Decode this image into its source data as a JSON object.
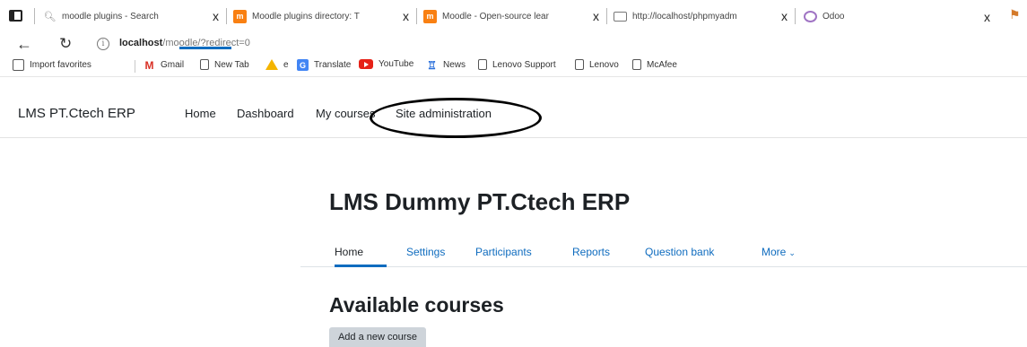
{
  "browser": {
    "tabs": [
      {
        "title": "moodle plugins - Search",
        "icon": "search-icon"
      },
      {
        "title": "Moodle plugins directory: T",
        "icon": "moodle-icon"
      },
      {
        "title": "Moodle - Open-source lear",
        "icon": "moodle-icon"
      },
      {
        "title": "http://localhost/phpmyadm",
        "icon": "page-icon"
      },
      {
        "title": "Odoo",
        "icon": "odoo-icon"
      }
    ],
    "tab_close_glyph": "x",
    "address": {
      "host": "localhost",
      "path": "/moodle/?redirect=0"
    },
    "bookmarks": [
      {
        "label": "Import favorites",
        "icon": "import-icon"
      },
      {
        "label": "Gmail",
        "icon": "gmail-icon"
      },
      {
        "label": "New Tab",
        "icon": "page-icon"
      },
      {
        "label": "e",
        "icon": "drive-icon"
      },
      {
        "label": "Translate",
        "icon": "translate-icon"
      },
      {
        "label": "YouTube",
        "icon": "youtube-icon"
      },
      {
        "label": "News",
        "icon": "news-icon"
      },
      {
        "label": "Lenovo Support",
        "icon": "page-icon"
      },
      {
        "label": "Lenovo",
        "icon": "page-icon"
      },
      {
        "label": "McAfee",
        "icon": "page-icon"
      }
    ]
  },
  "moodle": {
    "brand": "LMS PT.Ctech ERP",
    "primary_nav": [
      "Home",
      "Dashboard",
      "My courses",
      "Site administration"
    ],
    "primary_active": "Home",
    "page_title": "LMS Dummy PT.Ctech ERP",
    "secondary_nav": [
      "Home",
      "Settings",
      "Participants",
      "Reports",
      "Question bank",
      "More"
    ],
    "secondary_active": "Home",
    "courses_heading": "Available courses",
    "add_course_button": "Add a new course",
    "accent_color": "#0f6cbf"
  }
}
